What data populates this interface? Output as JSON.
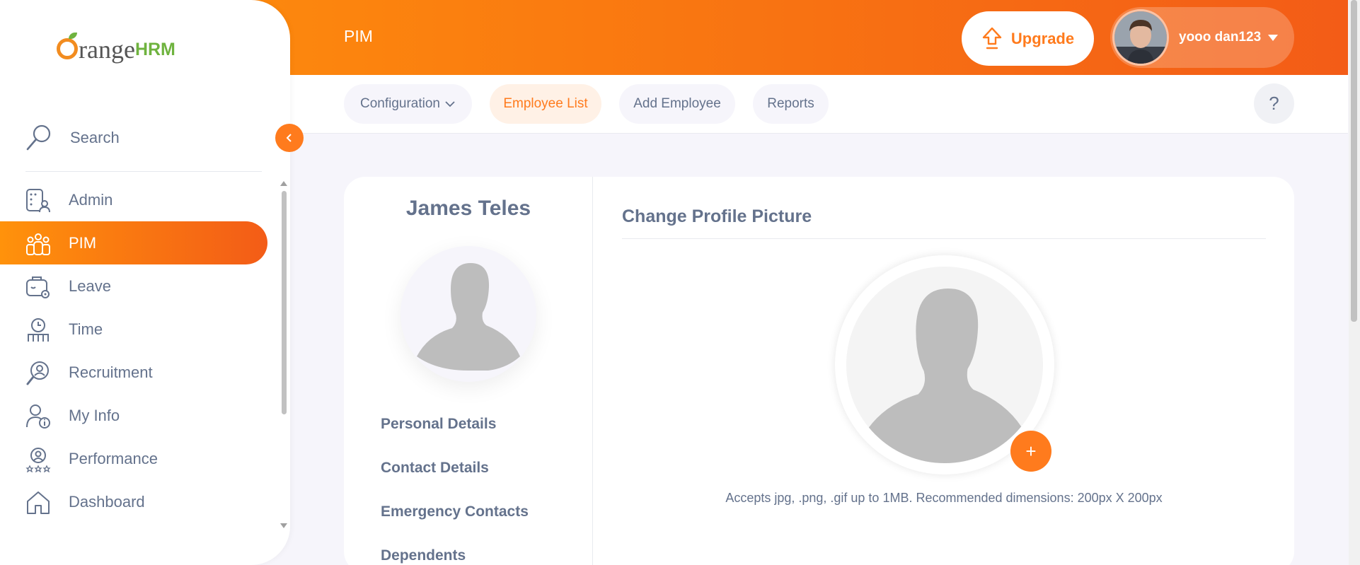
{
  "header": {
    "title": "PIM",
    "upgrade_label": "Upgrade",
    "user_name": "yooo dan123"
  },
  "subnav": {
    "tabs": [
      {
        "label": "Configuration",
        "has_dropdown": true
      },
      {
        "label": "Employee List",
        "active": true
      },
      {
        "label": "Add Employee"
      },
      {
        "label": "Reports"
      }
    ],
    "help_label": "?"
  },
  "sidebar": {
    "logo": {
      "o": "O",
      "rest": "range",
      "suffix": "HRM"
    },
    "search_label": "Search",
    "items": [
      {
        "label": "Admin",
        "icon": "admin-icon"
      },
      {
        "label": "PIM",
        "icon": "pim-icon",
        "active": true
      },
      {
        "label": "Leave",
        "icon": "leave-icon"
      },
      {
        "label": "Time",
        "icon": "time-icon"
      },
      {
        "label": "Recruitment",
        "icon": "recruitment-icon"
      },
      {
        "label": "My Info",
        "icon": "my-info-icon"
      },
      {
        "label": "Performance",
        "icon": "performance-icon"
      },
      {
        "label": "Dashboard",
        "icon": "dashboard-icon"
      }
    ]
  },
  "profile": {
    "employee_name": "James Teles",
    "links": [
      "Personal Details",
      "Contact Details",
      "Emergency Contacts",
      "Dependents"
    ]
  },
  "main": {
    "section_title": "Change Profile Picture",
    "add_label": "+",
    "hint": "Accepts jpg, .png, .gif up to 1MB. Recommended dimensions: 200px X 200px"
  },
  "colors": {
    "accent": "#ff7b1d",
    "gradient_start": "#ff920b",
    "gradient_end": "#f35c17",
    "text": "#64728c"
  }
}
